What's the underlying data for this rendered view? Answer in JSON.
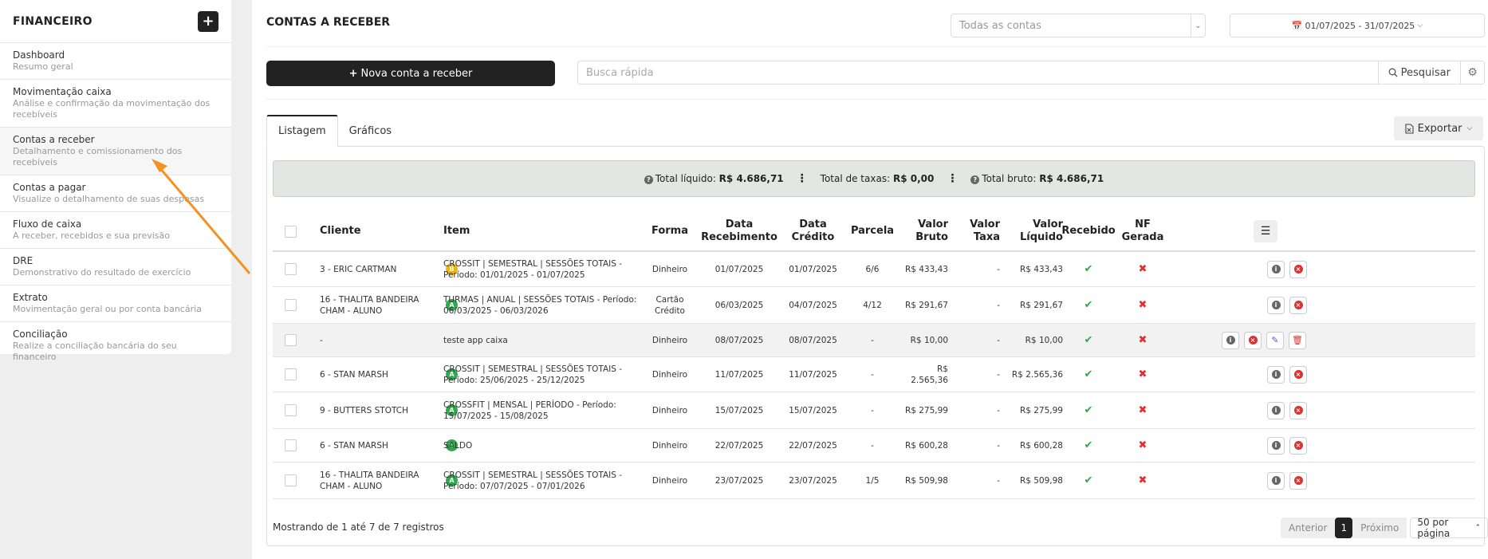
{
  "sidebar": {
    "title": "FINANCEIRO",
    "add_icon": "plus-icon",
    "items": [
      {
        "label": "Dashboard",
        "sub": "Resumo geral"
      },
      {
        "label": "Movimentação caixa",
        "sub": "Análise e confirmação da movimentação dos recebíveis"
      },
      {
        "label": "Contas a receber",
        "sub": "Detalhamento e comissionamento dos recebíveis"
      },
      {
        "label": "Contas a pagar",
        "sub": "Visualize o detalhamento de suas despesas"
      },
      {
        "label": "Fluxo de caixa",
        "sub": "A receber, recebidos e sua previsão"
      },
      {
        "label": "DRE",
        "sub": "Demonstrativo do resultado de exercício"
      },
      {
        "label": "Extrato",
        "sub": "Movimentação geral ou por conta bancária"
      },
      {
        "label": "Conciliação",
        "sub": "Realize a conciliação bancária do seu financeiro"
      }
    ],
    "active_index": 2
  },
  "header": {
    "title": "CONTAS A RECEBER",
    "accounts_select": "Todas as contas",
    "date_range": "01/07/2025 - 31/07/2025"
  },
  "toolbar": {
    "new_label": "Nova conta a receber",
    "search_placeholder": "Busca rápida",
    "search_label": "Pesquisar"
  },
  "tabs": {
    "listagem": "Listagem",
    "graficos": "Gráficos",
    "export": "Exportar"
  },
  "totals": {
    "liquido_label": "Total líquido:",
    "liquido_value": "R$ 4.686,71",
    "taxas_label": "Total de taxas:",
    "taxas_value": "R$ 0,00",
    "bruto_label": "Total bruto:",
    "bruto_value": "R$ 4.686,71"
  },
  "table": {
    "headers": {
      "cliente": "Cliente",
      "item": "Item",
      "forma": "Forma",
      "data_rec_1": "Data",
      "data_rec_2": "Recebimento",
      "data_cred_1": "Data",
      "data_cred_2": "Crédito",
      "parcela": "Parcela",
      "bruto_1": "Valor",
      "bruto_2": "Bruto",
      "taxa_1": "Valor",
      "taxa_2": "Taxa",
      "liquido_1": "Valor",
      "liquido_2": "Líquido",
      "recebido": "Recebido",
      "nf_1": "NF",
      "nf_2": "Gerada"
    },
    "rows": [
      {
        "cliente": "3 - ERIC CARTMAN",
        "badge": "B",
        "item": "CROSSIT | SEMESTRAL | SESSÕES TOTAIS - Período: 01/01/2025 - 01/07/2025",
        "forma": "Dinheiro",
        "data_rec": "01/07/2025",
        "data_cred": "01/07/2025",
        "parcela": "6/6",
        "bruto": "R$ 433,43",
        "taxa": "-",
        "liquido": "R$ 433,43"
      },
      {
        "cliente": "16 - THALITA BANDEIRA CHAM - ALUNO",
        "badge": "A",
        "item": "TURMAS | ANUAL | SESSÕES TOTAIS - Período: 06/03/2025 - 06/03/2026",
        "forma": "Cartão Crédito",
        "data_rec": "06/03/2025",
        "data_cred": "04/07/2025",
        "parcela": "4/12",
        "bruto": "R$ 291,67",
        "taxa": "-",
        "liquido": "R$ 291,67"
      },
      {
        "cliente": "-",
        "badge": "",
        "item": "teste app caixa",
        "forma": "Dinheiro",
        "data_rec": "08/07/2025",
        "data_cred": "08/07/2025",
        "parcela": "-",
        "bruto": "R$ 10,00",
        "taxa": "-",
        "liquido": "R$ 10,00"
      },
      {
        "cliente": "6 - STAN MARSH",
        "badge": "A",
        "item": "CROSSIT | SEMESTRAL | SESSÕES TOTAIS - Período: 25/06/2025 - 25/12/2025",
        "forma": "Dinheiro",
        "data_rec": "11/07/2025",
        "data_cred": "11/07/2025",
        "parcela": "-",
        "bruto": "R$ 2.565,36",
        "taxa": "-",
        "liquido": "R$ 2.565,36"
      },
      {
        "cliente": "9 - BUTTERS STOTCH",
        "badge": "A",
        "item": "CROSSFIT | MENSAL | PERÍODO - Período: 15/07/2025 - 15/08/2025",
        "forma": "Dinheiro",
        "data_rec": "15/07/2025",
        "data_cred": "15/07/2025",
        "parcela": "-",
        "bruto": "R$ 275,99",
        "taxa": "-",
        "liquido": "R$ 275,99"
      },
      {
        "cliente": "6 - STAN MARSH",
        "badge": "A",
        "item": "SALDO",
        "forma": "Dinheiro",
        "data_rec": "22/07/2025",
        "data_cred": "22/07/2025",
        "parcela": "-",
        "bruto": "R$ 600,28",
        "taxa": "-",
        "liquido": "R$ 600,28"
      },
      {
        "cliente": "16 - THALITA BANDEIRA CHAM - ALUNO",
        "badge": "A",
        "item": "CROSSIT | SEMESTRAL | SESSÕES TOTAIS - Período: 07/07/2025 - 07/01/2026",
        "forma": "Dinheiro",
        "data_rec": "23/07/2025",
        "data_cred": "23/07/2025",
        "parcela": "1/5",
        "bruto": "R$ 509,98",
        "taxa": "-",
        "liquido": "R$ 509,98"
      }
    ]
  },
  "footer": {
    "showing": "Mostrando de 1 até 7 de 7 registros",
    "prev": "Anterior",
    "page": "1",
    "next": "Próximo",
    "page_size": "50 por página"
  },
  "colors": {
    "accent": "#222222",
    "success": "#2fa84f",
    "danger": "#e03030",
    "annotation_arrow": "#f39223"
  }
}
